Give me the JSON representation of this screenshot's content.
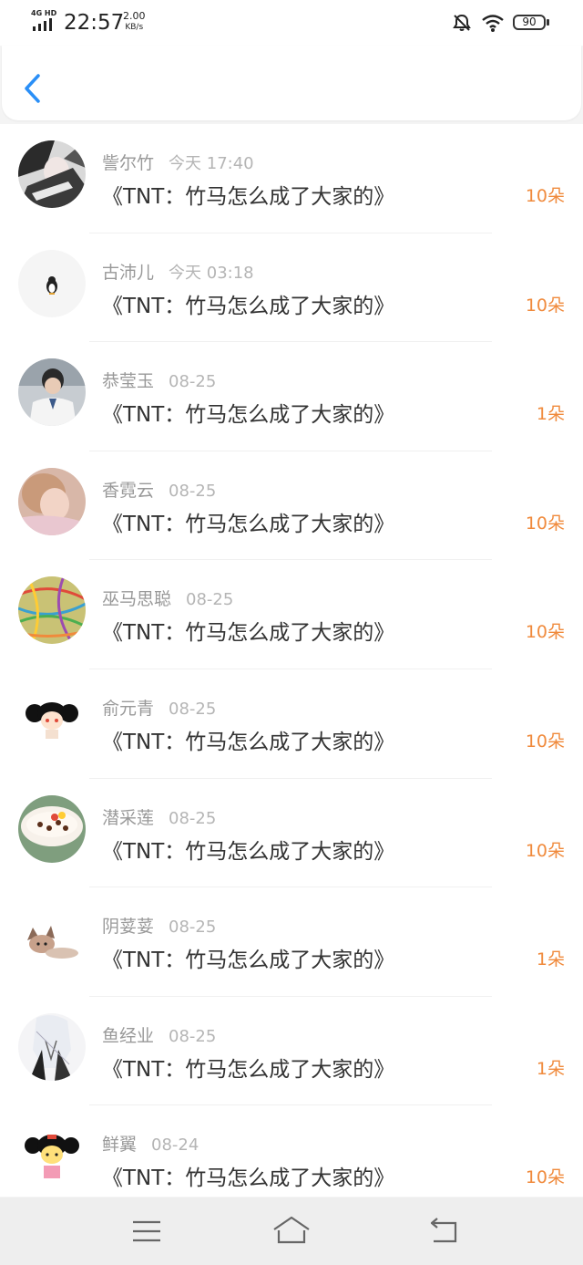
{
  "status_bar": {
    "network": "4G HD",
    "time": "22:57",
    "speed_value": "2.00",
    "speed_unit": "KB/s",
    "battery": "90",
    "icons": [
      "signal-icon",
      "mute-bell-icon",
      "wifi-icon",
      "battery-icon"
    ]
  },
  "header": {
    "back_icon": "chevron-left-icon",
    "accent_color": "#2a8ff7"
  },
  "colors": {
    "amount": "#f08a3c",
    "name": "#999999",
    "title": "#333333"
  },
  "list": [
    {
      "name": "訾尔竹",
      "date": "今天 17:40",
      "title": "《TNT：竹马怎么成了大家的》",
      "amount": "10朵",
      "avatar": "avatar-bw-anime"
    },
    {
      "name": "古沛儿",
      "date": "今天 03:18",
      "title": "《TNT：竹马怎么成了大家的》",
      "amount": "10朵",
      "avatar": "avatar-penguin"
    },
    {
      "name": "恭莹玉",
      "date": "08-25",
      "title": "《TNT：竹马怎么成了大家的》",
      "amount": "1朵",
      "avatar": "avatar-student"
    },
    {
      "name": "香霓云",
      "date": "08-25",
      "title": "《TNT：竹马怎么成了大家的》",
      "amount": "10朵",
      "avatar": "avatar-child"
    },
    {
      "name": "巫马思聪",
      "date": "08-25",
      "title": "《TNT：竹马怎么成了大家的》",
      "amount": "10朵",
      "avatar": "avatar-yarn-ball"
    },
    {
      "name": "俞元青",
      "date": "08-25",
      "title": "《TNT：竹马怎么成了大家的》",
      "amount": "10朵",
      "avatar": "avatar-cartoon-girl"
    },
    {
      "name": "潜采莲",
      "date": "08-25",
      "title": "《TNT：竹马怎么成了大家的》",
      "amount": "10朵",
      "avatar": "avatar-cereal-bowl"
    },
    {
      "name": "阴荽荽",
      "date": "08-25",
      "title": "《TNT：竹马怎么成了大家的》",
      "amount": "1朵",
      "avatar": "avatar-cat-anime"
    },
    {
      "name": "鱼经业",
      "date": "08-25",
      "title": "《TNT：竹马怎么成了大家的》",
      "amount": "1朵",
      "avatar": "avatar-white-hair-anime"
    },
    {
      "name": "鲜翼",
      "date": "08-24",
      "title": "《TNT：竹马怎么成了大家的》",
      "amount": "10朵",
      "avatar": "avatar-cartoon-doll"
    }
  ],
  "nav": {
    "icons": [
      "menu-icon",
      "home-icon",
      "back-nav-icon"
    ]
  }
}
